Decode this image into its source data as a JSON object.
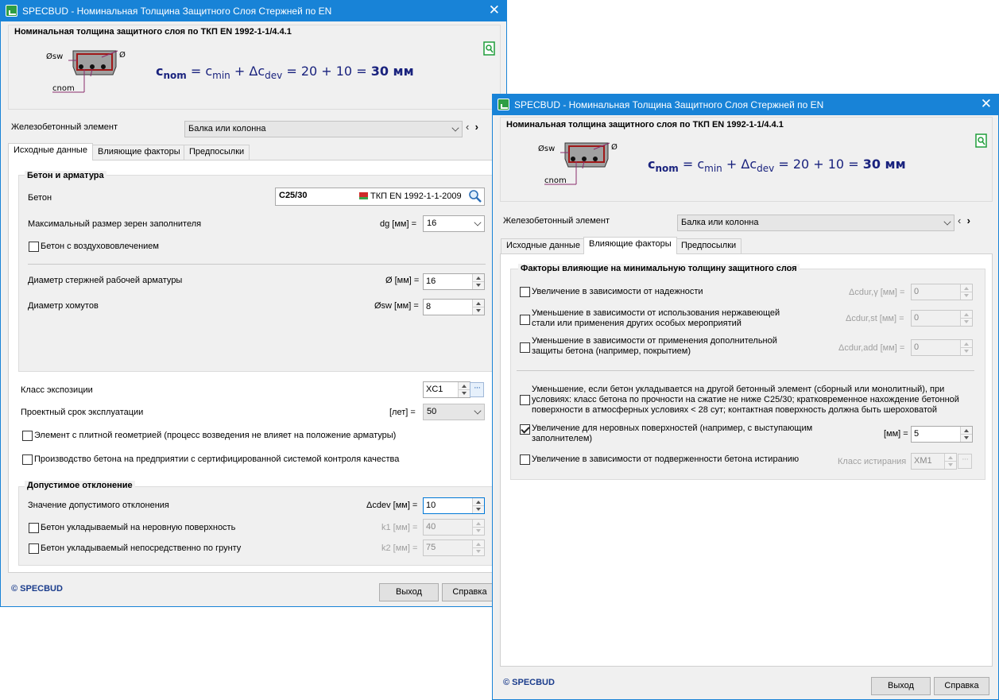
{
  "app": {
    "title": "SPECBUD - Номинальная Толщина Защитного Слоя Стержней по EN",
    "close_glyph": "✕",
    "copyright": "© SPECBUD"
  },
  "header": {
    "title": "Номинальная толщина защитного слоя по ТКП EN 1992-1-1/4.4.1",
    "diagram": {
      "phi_sw": "Øsw",
      "phi": "Ø",
      "c_nom": "cnom"
    },
    "formula": {
      "c": "c",
      "nom": "nom",
      "eq": " = ",
      "c2": "c",
      "min": "min",
      "plus": " + Δc",
      "dev": "dev",
      "tail": " = 20 + 10 = ",
      "result": "30 мм"
    }
  },
  "element": {
    "label": "Железобетонный элемент",
    "value": "Балка или колонна",
    "nav_prev": "‹",
    "nav_next": "›"
  },
  "tabs": [
    "Исходные данные",
    "Влияющие факторы",
    "Предпосылки"
  ],
  "input_tab": {
    "group1_title": "Бетон и арматура",
    "concrete_label": "Бетон",
    "concrete_value": "C25/30",
    "concrete_norm": "ТКП EN 1992-1-1-2009",
    "aggregate_label": "Максимальный размер зерен заполнителя",
    "aggregate_symbol": "dg [мм] =",
    "aggregate_value": "16",
    "air_label": "Бетон с воздухововлечением",
    "rebar_label": "Диаметр стержней рабочей арматуры",
    "rebar_symbol": "Ø [мм] =",
    "rebar_value": "16",
    "stirrup_label": "Диаметр хомутов",
    "stirrup_symbol": "Øsw [мм] =",
    "stirrup_value": "8",
    "exposure_label": "Класс экспозиции",
    "exposure_value": "XC1",
    "life_label": "Проектный срок эксплуатации",
    "life_unit": "[лет] =",
    "life_value": "50",
    "slab_label": "Элемент с плитной геометрией (процесс возведения не влияет на положение арматуры)",
    "quality_label": "Производство бетона на предприятии с сертифицированной системой контроля качества",
    "group2_title": "Допустимое отклонение",
    "dev_label": "Значение допустимого отклонения",
    "dev_symbol": "Δcdev [мм] =",
    "dev_value": "10",
    "uneven_label": "Бетон укладываемый на неровную поверхность",
    "uneven_symbol": "k1 [мм] =",
    "uneven_value": "40",
    "ground_label": "Бетон укладываемый непосредственно по грунту",
    "ground_symbol": "k2 [мм] =",
    "ground_value": "75"
  },
  "factors_tab": {
    "group_title": "Факторы влияющие на минимальную толщину защитного слоя",
    "f1_label": "Увеличение в зависимости от надежности",
    "f1_symbol": "Δcdur,γ [мм] =",
    "f1_value": "0",
    "f2_label": "Уменьшение в зависимости от использования нержавеющей стали или применения других особых мероприятий",
    "f2_symbol": "Δcdur,st [мм] =",
    "f2_value": "0",
    "f3_label": "Уменьшение в зависимости от применения дополнительной защиты бетона (например, покрытием)",
    "f3_symbol": "Δcdur,add [мм] =",
    "f3_value": "0",
    "f4_label": "Уменьшение, если бетон укладывается на другой бетонный элемент (сборный или монолитный), при условиях: класс бетона по прочности на сжатие не ниже C25/30; кратковременное нахождение бетонной поверхности в атмосферных условиях < 28 сут; контактная поверхность должна быть шероховатой",
    "f5_label": "Увеличение для неровных поверхностей (например, с выступающим заполнителем)",
    "f5_symbol": "[мм] =",
    "f5_value": "5",
    "f6_label": "Увеличение в зависимости от подверженности бетона истиранию",
    "f6_symbol": "Класс истирания",
    "f6_value": "XM1"
  },
  "buttons": {
    "exit": "Выход",
    "help": "Справка"
  },
  "colors": {
    "titlebar": "#1883d7",
    "formula": "#1a237e",
    "brand": "#1a3c8c"
  }
}
